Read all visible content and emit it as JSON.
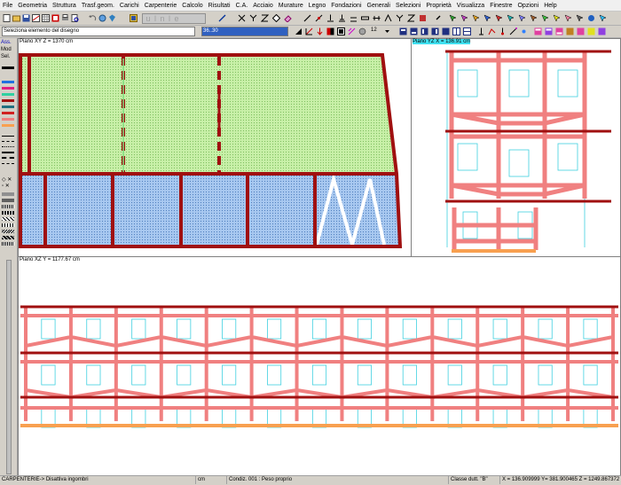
{
  "menu": [
    "File",
    "Geometria",
    "Struttura",
    "Trasf.geom.",
    "Carichi",
    "Carpenterie",
    "Calcolo",
    "Risultati",
    "C.A.",
    "Acciaio",
    "Murature",
    "Legno",
    "Fondazioni",
    "Generali",
    "Selezioni",
    "Proprietà",
    "Visualizza",
    "Finestre",
    "Opzioni",
    "Help"
  ],
  "toolbar": {
    "select_hint": "Seleziona  elemento del disegno",
    "coord_value": "36..30",
    "zoom_value": "12"
  },
  "left_panel": {
    "tabs": [
      "Ass.",
      "Mod",
      "Sel."
    ]
  },
  "views": {
    "plan_xy": {
      "label": "Piano XY   Z = 1370 cm"
    },
    "plan_yz": {
      "label": "Piano YZ   X = 136.91 cm"
    },
    "plan_xz": {
      "label": "Piano XZ   Y = 1177.67 cm"
    }
  },
  "status": {
    "mode": "CARPENTERIE-> Disattiva ingombri",
    "units": "cm",
    "condition": "Condiz. 001 : Peso proprio",
    "ductility": "Classe dutt. \"B\"",
    "coords": "X = 136.909999 Y= 381.900465 Z = 1249.867372"
  },
  "colors": {
    "beam": "#a01010",
    "slab_green": "#c8f0a8",
    "slab_blue": "#a8c8f0",
    "member": "#f08080",
    "opening": "#40d0e0",
    "foundation": "#f8a050"
  }
}
